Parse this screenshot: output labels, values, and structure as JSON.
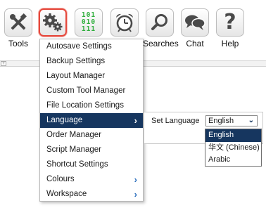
{
  "toolbar": {
    "buttons": [
      {
        "label": "Tools",
        "icon": "tools-icon"
      },
      {
        "label": "",
        "icon": "gears-icon"
      },
      {
        "label": "",
        "icon": "binary-icon",
        "binary_rows": [
          "101",
          "010",
          "111"
        ]
      },
      {
        "label": "",
        "icon": "alarm-clock-icon"
      },
      {
        "label": "Searches",
        "icon": "search-icon"
      },
      {
        "label": "Chat",
        "icon": "chat-icon"
      },
      {
        "label": "Help",
        "icon": "question-icon"
      }
    ],
    "active_highlight_color": "#e5483c"
  },
  "menu": {
    "items": [
      {
        "label": "Autosave Settings",
        "has_submenu": false
      },
      {
        "label": "Backup Settings",
        "has_submenu": false
      },
      {
        "label": "Layout Manager",
        "has_submenu": false
      },
      {
        "label": "Custom Tool Manager",
        "has_submenu": false
      },
      {
        "label": "File Location Settings",
        "has_submenu": false
      },
      {
        "label": "Language",
        "has_submenu": true,
        "selected": true
      },
      {
        "label": "Order Manager",
        "has_submenu": false
      },
      {
        "label": "Script Manager",
        "has_submenu": false
      },
      {
        "label": "Shortcut Settings",
        "has_submenu": false
      },
      {
        "label": "Colours",
        "has_submenu": true
      },
      {
        "label": "Workspace",
        "has_submenu": true
      }
    ],
    "selected_color": "#16365f"
  },
  "language": {
    "label": "Set Language",
    "current_value": "English",
    "options": [
      "English",
      "华文 (Chinese)",
      "Arabic"
    ],
    "selected_option": "English"
  }
}
